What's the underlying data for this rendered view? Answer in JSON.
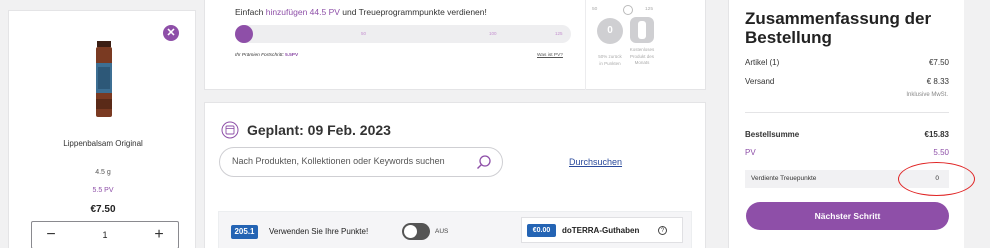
{
  "product": {
    "remove_icon": "close-icon",
    "name": "Lippenbalsam Original",
    "size": "4.5 g",
    "pv": "5.5 PV",
    "price": "€7.50",
    "quantity": "1",
    "minus": "−",
    "plus": "+"
  },
  "loyalty": {
    "header_prefix": "Einfach ",
    "header_highlight": "hinzufügen 44.5 PV",
    "header_suffix": " und Treueprogrammpunkte verdienen!",
    "progress_fraction": 0.044,
    "tick_labels": [
      "50",
      "100",
      "125"
    ],
    "caption_prefix": "Ihr Prämien Fortschritt: ",
    "caption_value": "5.5PV",
    "link": "Was ist PV?",
    "reward_thresholds": [
      "50",
      "125"
    ],
    "reward_points_value": "0",
    "reward_points_text": [
      "50% zurück",
      "in Punkten"
    ],
    "reward_product_text": [
      "Kostenloses",
      "Produkt des",
      "Monats"
    ]
  },
  "planned": {
    "title": "Geplant: 09 Feb. 2023",
    "search_placeholder": "Nach Produkten, Kollektionen oder Keywords suchen",
    "browse_link": "Durchsuchen",
    "points_badge": "205.1",
    "points_text": "Verwenden Sie Ihre Punkte!",
    "toggle_label": "AUS",
    "credit_badge": "€0.00",
    "credit_label": "doTERRA-Guthaben",
    "info_glyph": "?"
  },
  "summary": {
    "title": "Zusammenfassung der Bestellung",
    "items_label": "Artikel (1)",
    "items_value": "€7.50",
    "shipping_label": "Versand",
    "shipping_value": "€ 8.33",
    "tax_note": "Inklusive MwSt.",
    "total_label": "Bestellsumme",
    "total_value": "€15.83",
    "pv_label": "PV",
    "pv_value": "5.50",
    "earned_label": "Verdiente Treuepunkte",
    "earned_value": "0",
    "next_button": "Nächster Schritt"
  },
  "colors": {
    "accent": "#8e4fa8",
    "badge_blue": "#2464b4",
    "annotation_red": "#e02424"
  }
}
